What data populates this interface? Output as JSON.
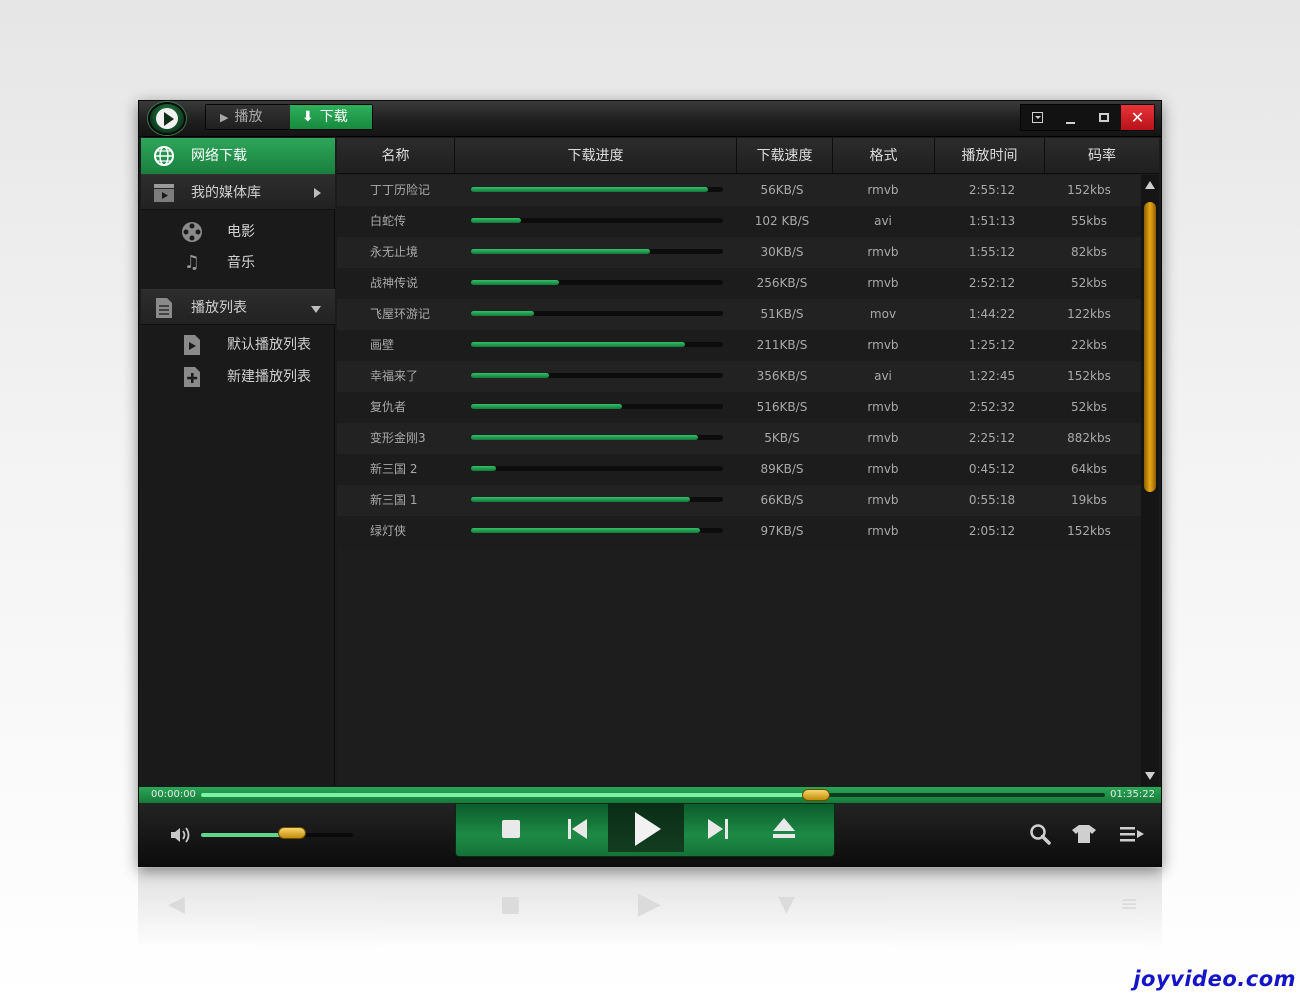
{
  "tabs": {
    "play": "播放",
    "download": "下载"
  },
  "sidebar": {
    "network_download": "网络下载",
    "media_library": "我的媒体库",
    "movies": "电影",
    "music": "音乐",
    "playlists": "播放列表",
    "default_playlist": "默认播放列表",
    "new_playlist": "新建播放列表"
  },
  "table": {
    "headers": {
      "name": "名称",
      "progress": "下载进度",
      "speed": "下载速度",
      "format": "格式",
      "duration": "播放时间",
      "bitrate": "码率"
    },
    "rows": [
      {
        "name": "丁丁历险记",
        "progress": 0.94,
        "speed": "56KB/S",
        "format": "rmvb",
        "duration": "2:55:12",
        "bitrate": "152kbs"
      },
      {
        "name": "白蛇传",
        "progress": 0.2,
        "speed": "102 KB/S",
        "format": "avi",
        "duration": "1:51:13",
        "bitrate": "55kbs"
      },
      {
        "name": "永无止境",
        "progress": 0.71,
        "speed": "30KB/S",
        "format": "rmvb",
        "duration": "1:55:12",
        "bitrate": "82kbs"
      },
      {
        "name": "战神传说",
        "progress": 0.35,
        "speed": "256KB/S",
        "format": "rmvb",
        "duration": "2:52:12",
        "bitrate": "52kbs"
      },
      {
        "name": "飞屋环游记",
        "progress": 0.25,
        "speed": "51KB/S",
        "format": "mov",
        "duration": "1:44:22",
        "bitrate": "122kbs"
      },
      {
        "name": "画壁",
        "progress": 0.85,
        "speed": "211KB/S",
        "format": "rmvb",
        "duration": "1:25:12",
        "bitrate": "22kbs"
      },
      {
        "name": "幸福来了",
        "progress": 0.31,
        "speed": "356KB/S",
        "format": "avi",
        "duration": "1:22:45",
        "bitrate": "152kbs"
      },
      {
        "name": "复仇者",
        "progress": 0.6,
        "speed": "516KB/S",
        "format": "rmvb",
        "duration": "2:52:32",
        "bitrate": "52kbs"
      },
      {
        "name": "变形金刚3",
        "progress": 0.9,
        "speed": "5KB/S",
        "format": "rmvb",
        "duration": "2:25:12",
        "bitrate": "882kbs"
      },
      {
        "name": "新三国 2",
        "progress": 0.1,
        "speed": "89KB/S",
        "format": "rmvb",
        "duration": "0:45:12",
        "bitrate": "64kbs"
      },
      {
        "name": "新三国 1",
        "progress": 0.87,
        "speed": "66KB/S",
        "format": "rmvb",
        "duration": "0:55:18",
        "bitrate": "19kbs"
      },
      {
        "name": "绿灯侠",
        "progress": 0.91,
        "speed": "97KB/S",
        "format": "rmvb",
        "duration": "2:05:12",
        "bitrate": "152kbs"
      }
    ]
  },
  "seek": {
    "current": "00:00:00",
    "total": "01:35:22",
    "position": 0.68
  },
  "volume": {
    "level": 0.6
  },
  "watermark": "joyvideo.com",
  "colors": {
    "accent": "#1f9b4c",
    "close": "#d21f26",
    "knob": "#e0a91c"
  }
}
